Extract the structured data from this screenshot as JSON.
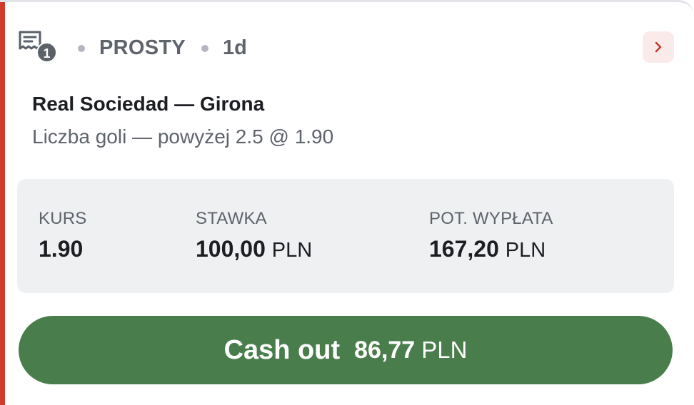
{
  "colors": {
    "accent_bar": "#d23a2c",
    "cashout_green": "#4a7d4c",
    "summary_bg": "#eef0f2",
    "chevron_bg": "#fbeaea",
    "chevron_color": "#c0392b",
    "muted_text": "#5f636b"
  },
  "header": {
    "icon": "ticket-receipt-icon",
    "selection_count": "1",
    "bet_type": "PROSTY",
    "age": "1d",
    "details_icon": "chevron-right-icon"
  },
  "event": {
    "title": "Real Sociedad — Girona",
    "selection": "Liczba goli — powyżej 2.5 @ 1.90"
  },
  "summary": {
    "odds": {
      "label": "KURS",
      "value": "1.90"
    },
    "stake": {
      "label": "STAWKA",
      "value": "100,00",
      "currency": "PLN"
    },
    "payout": {
      "label": "POT. WYPŁATA",
      "value": "167,20",
      "currency": "PLN"
    }
  },
  "cashout": {
    "label": "Cash out",
    "amount": "86,77",
    "currency": "PLN"
  }
}
